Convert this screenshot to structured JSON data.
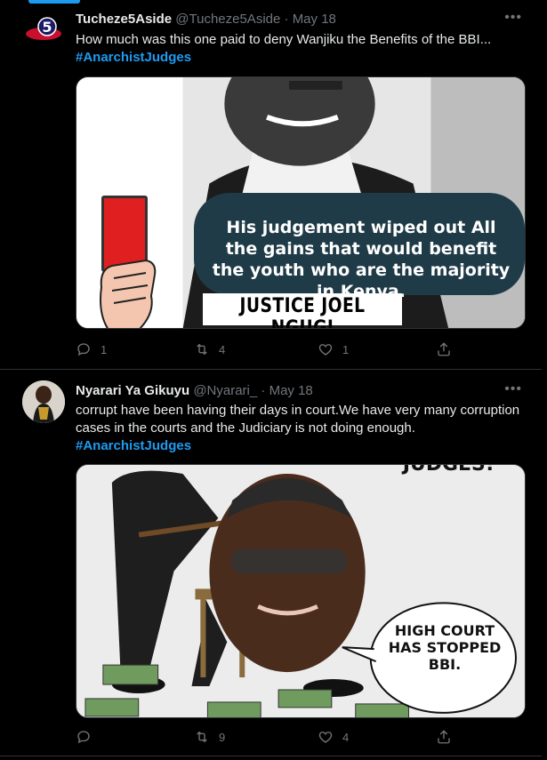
{
  "tweets": [
    {
      "author_name": "Tucheze5Aside",
      "handle": "@Tucheze5Aside",
      "separator": "·",
      "date": "May 18",
      "text": "How much was this one paid to deny Wanjiku the Benefits of the BBI...",
      "hashtag": "#AnarchistJudges",
      "media_caption": "His judgement wiped out All the gains that would benefit the youth who are the majority in Kenya.",
      "media_name": "JUSTICE JOEL NGUGI",
      "avatar_logo_text": "5",
      "stats": {
        "replies": "1",
        "retweets": "4",
        "likes": "1"
      }
    },
    {
      "author_name": "Nyarari Ya Gikuyu",
      "handle": "@Nyarari_",
      "separator": "·",
      "date": "May 18",
      "text": "corrupt have been having their days in court.We have very many corruption cases in the courts and the Judiciary is not doing enough.",
      "hashtag": "#AnarchistJudges",
      "media_speech": "HIGH COURT HAS STOPPED BBI.",
      "media_top_text": "JUDGES!",
      "stats": {
        "replies": "",
        "retweets": "9",
        "likes": "4"
      }
    }
  ],
  "more_icon": "more-horizontal-icon",
  "colors": {
    "background": "#000000",
    "accent": "#1d9bf0",
    "muted": "#71767b",
    "text": "#e7e9ea",
    "border": "#2f3336"
  }
}
